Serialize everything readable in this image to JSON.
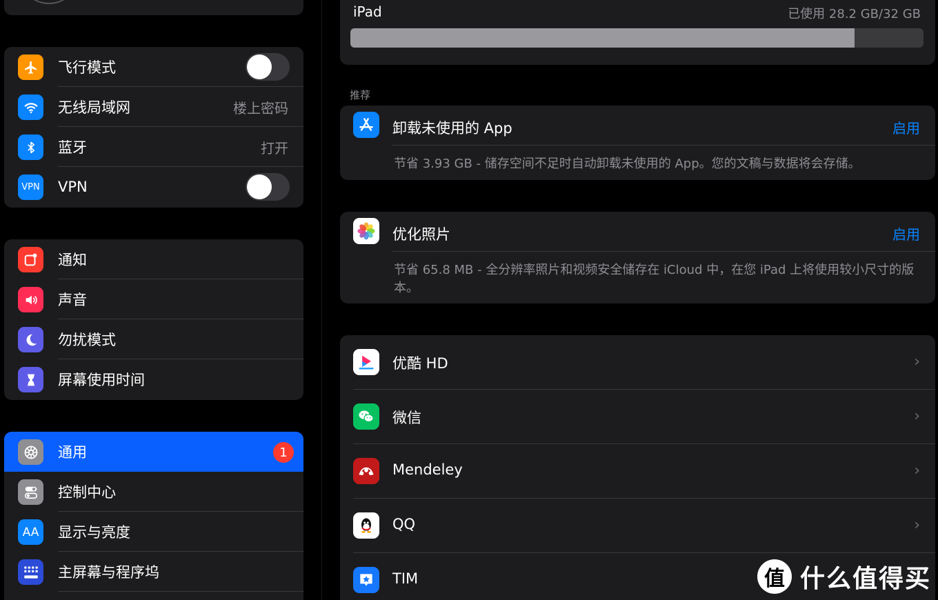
{
  "sidebar": {
    "connectivity": [
      {
        "label": "飞行模式",
        "icon": "airplane-icon",
        "color": "#ff9500",
        "toggle": false
      },
      {
        "label": "无线局域网",
        "icon": "wifi-icon",
        "color": "#0a84ff",
        "value": "楼上密码"
      },
      {
        "label": "蓝牙",
        "icon": "bluetooth-icon",
        "color": "#0a84ff",
        "value": "打开"
      },
      {
        "label": "VPN",
        "icon": "vpn-icon",
        "icon_text": "VPN",
        "color": "#0a84ff",
        "toggle": false
      }
    ],
    "notifications": [
      {
        "label": "通知",
        "icon": "notifications-icon",
        "color": "#ff3b30"
      },
      {
        "label": "声音",
        "icon": "sound-icon",
        "color": "#ff2d55"
      },
      {
        "label": "勿扰模式",
        "icon": "moon-icon",
        "color": "#5e5ce6"
      },
      {
        "label": "屏幕使用时间",
        "icon": "hourglass-icon",
        "color": "#5e5ce6"
      }
    ],
    "general": [
      {
        "label": "通用",
        "icon": "gear-icon",
        "color": "#8e8e93",
        "badge": "1",
        "selected": true
      },
      {
        "label": "控制中心",
        "icon": "control-center-icon",
        "color": "#8e8e93"
      },
      {
        "label": "显示与亮度",
        "icon": "display-icon",
        "icon_text": "AA",
        "color": "#0a84ff"
      },
      {
        "label": "主屏幕与程序坞",
        "icon": "home-screen-icon",
        "color": "#2c4bd6"
      }
    ]
  },
  "storage": {
    "device": "iPad",
    "used_text": "已使用 28.2 GB/32 GB",
    "used_fraction": 0.88
  },
  "recommendations": {
    "header": "推荐",
    "items": [
      {
        "title": "卸载未使用的 App",
        "action": "启用",
        "icon": "app-store-icon",
        "color": "#0a84ff",
        "desc": "节省 3.93 GB - 储存空间不足时自动卸载未使用的 App。您的文稿与数据将会存储。"
      },
      {
        "title": "优化照片",
        "action": "启用",
        "icon": "photos-icon",
        "color": "#ffffff",
        "desc": "节省 65.8 MB - 全分辨率照片和视频安全储存在 iCloud 中，在您 iPad 上将使用较小尺寸的版本。"
      }
    ]
  },
  "apps": [
    {
      "label": "优酷 HD",
      "icon": "youku-icon",
      "color": "#ffffff"
    },
    {
      "label": "微信",
      "icon": "wechat-icon",
      "color": "#07c160"
    },
    {
      "label": "Mendeley",
      "icon": "mendeley-icon",
      "color": "#c21a1a"
    },
    {
      "label": "QQ",
      "icon": "qq-icon",
      "color": "#ffffff"
    },
    {
      "label": "TIM",
      "icon": "tim-icon",
      "color": "#1677ff"
    }
  ],
  "watermark": {
    "symbol": "值",
    "text": "什么值得买"
  }
}
